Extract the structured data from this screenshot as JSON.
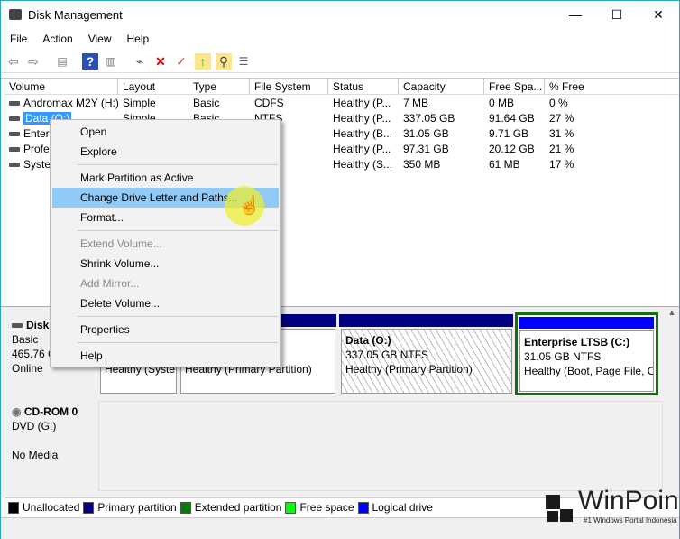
{
  "window": {
    "title": "Disk Management",
    "minimize": "—",
    "maximize": "☐",
    "close": "✕"
  },
  "menu": [
    "File",
    "Action",
    "View",
    "Help"
  ],
  "toolbar": [
    "back-icon",
    "forward-icon",
    "console-tree-icon",
    "help-icon",
    "show-pane-icon",
    "connect-icon",
    "delete-icon",
    "checklist-icon",
    "folder-up-icon",
    "folder-search-icon",
    "properties-icon"
  ],
  "columns": [
    "Volume",
    "Layout",
    "Type",
    "File System",
    "Status",
    "Capacity",
    "Free Spa...",
    "% Free"
  ],
  "rows": [
    [
      "Andromax M2Y (H:)",
      "Simple",
      "Basic",
      "CDFS",
      "Healthy (P...",
      "7 MB",
      "0 MB",
      "0 %"
    ],
    [
      "Data (O:)",
      "Simple",
      "Basic",
      "NTFS",
      "Healthy (P...",
      "337.05 GB",
      "91.64 GB",
      "27 %"
    ],
    [
      "Enterp",
      "",
      "",
      "",
      "Healthy (B...",
      "31.05 GB",
      "9.71 GB",
      "31 %"
    ],
    [
      "Profe",
      "",
      "",
      "",
      "Healthy (P...",
      "97.31 GB",
      "20.12 GB",
      "21 %"
    ],
    [
      "Syster",
      "",
      "",
      "",
      "Healthy (S...",
      "350 MB",
      "61 MB",
      "17 %"
    ]
  ],
  "context_menu": [
    {
      "label": "Open",
      "enabled": true
    },
    {
      "label": "Explore",
      "enabled": true
    },
    {
      "label": "Mark Partition as Active",
      "enabled": true
    },
    {
      "label": "Change Drive Letter and Paths...",
      "enabled": true,
      "highlighted": true
    },
    {
      "label": "Format...",
      "enabled": true
    },
    {
      "label": "Extend Volume...",
      "enabled": false
    },
    {
      "label": "Shrink Volume...",
      "enabled": true
    },
    {
      "label": "Add Mirror...",
      "enabled": false
    },
    {
      "label": "Delete Volume...",
      "enabled": true
    },
    {
      "label": "Properties",
      "enabled": true
    },
    {
      "label": "Help",
      "enabled": true
    }
  ],
  "disk0": {
    "name": "Disk",
    "type": "Basic",
    "size": "465.76 G",
    "status": "Online",
    "partitions": [
      {
        "status": "Healthy (Syste"
      },
      {
        "status": "Healthy (Primary Partition)"
      },
      {
        "name": "Data  (O:)",
        "size": "337.05 GB NTFS",
        "status": "Healthy (Primary Partition)"
      },
      {
        "name": "Enterprise LTSB  (C:)",
        "size": "31.05 GB NTFS",
        "status": "Healthy (Boot, Page File, C"
      }
    ]
  },
  "cdrom": {
    "name": "CD-ROM 0",
    "type": "DVD (G:)",
    "status": "No Media"
  },
  "legend": [
    {
      "label": "Unallocated",
      "color": "#000000"
    },
    {
      "label": "Primary partition",
      "color": "#000080"
    },
    {
      "label": "Extended partition",
      "color": "#008000"
    },
    {
      "label": "Free space",
      "color": "#00ff00"
    },
    {
      "label": "Logical drive",
      "color": "#0000ff"
    }
  ],
  "watermark": {
    "brand": "WinPoin",
    "tagline": "#1 Windows Portal Indonesia"
  }
}
